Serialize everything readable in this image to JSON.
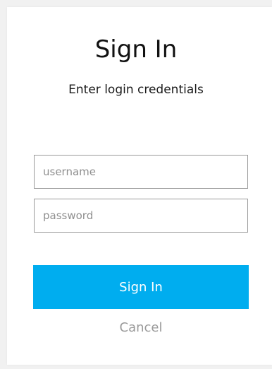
{
  "dialog": {
    "title": "Sign In",
    "subtitle": "Enter login credentials",
    "username": {
      "value": "",
      "placeholder": "username"
    },
    "password": {
      "value": "",
      "placeholder": "password"
    },
    "submit_label": "Sign In",
    "cancel_label": "Cancel"
  },
  "colors": {
    "background": "#f1f1f1",
    "dialog_background": "#ffffff",
    "primary_button": "#00adef",
    "primary_button_text": "#ffffff",
    "cancel_text": "#9a9a9a",
    "field_border": "#9a9a9a",
    "placeholder_text": "#8f8f8f"
  }
}
